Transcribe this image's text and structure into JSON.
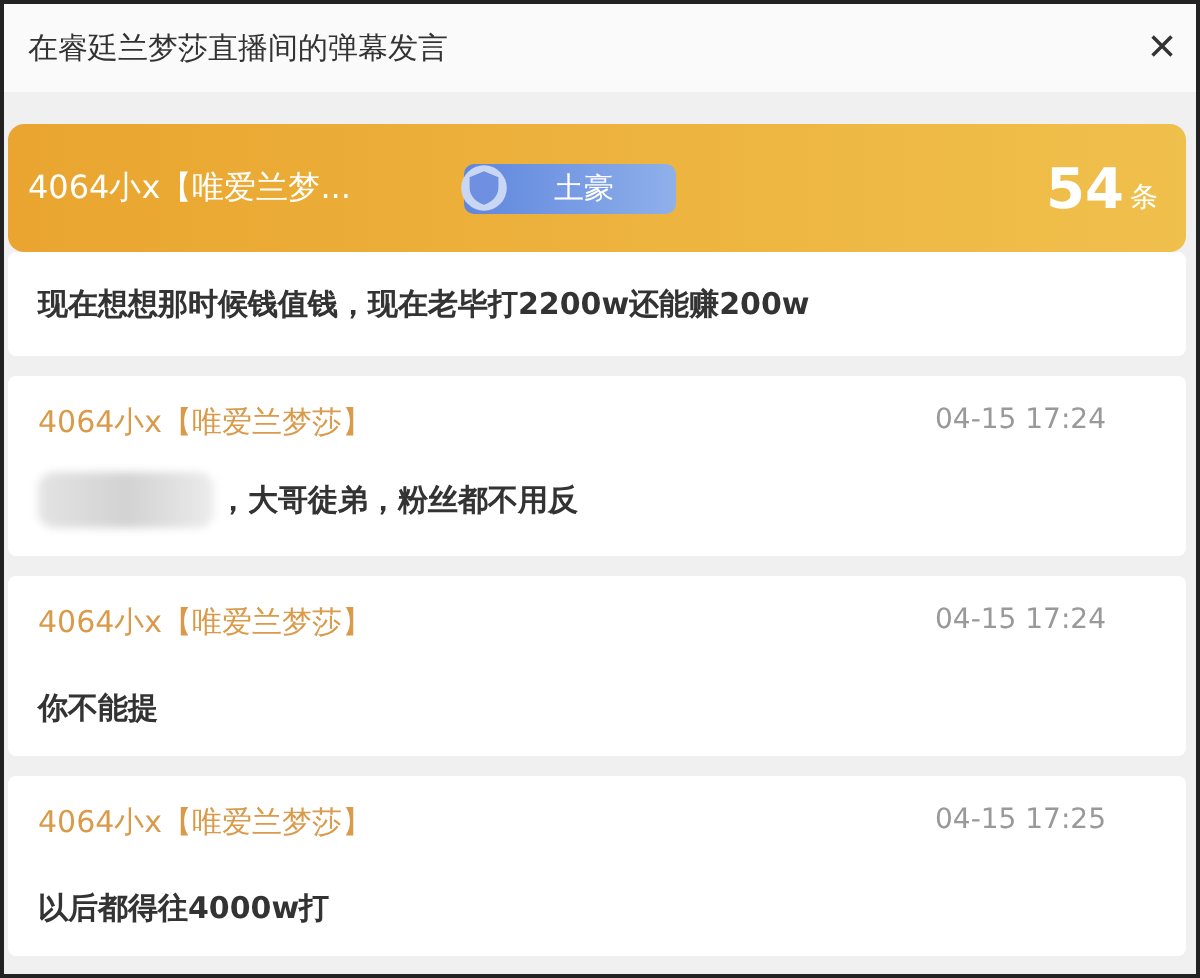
{
  "window": {
    "title": "在睿廷兰梦莎直播间的弹幕发言",
    "close": "×"
  },
  "user": {
    "name": "4064小x【唯爱兰梦...",
    "badge": "土豪",
    "count": "54",
    "count_unit": "条",
    "latest": "现在想想那时候钱值钱，现在老毕打2200w还能赚200w"
  },
  "messages": [
    {
      "sender": "4064小x【唯爱兰梦莎】",
      "time": "04-15 17:24",
      "text": "，大哥徒弟，粉丝都不用反",
      "redacted": true
    },
    {
      "sender": "4064小x【唯爱兰梦莎】",
      "time": "04-15 17:24",
      "text": "你不能提",
      "redacted": false
    },
    {
      "sender": "4064小x【唯爱兰梦莎】",
      "time": "04-15 17:25",
      "text": "以后都得往4000w打",
      "redacted": false
    }
  ]
}
